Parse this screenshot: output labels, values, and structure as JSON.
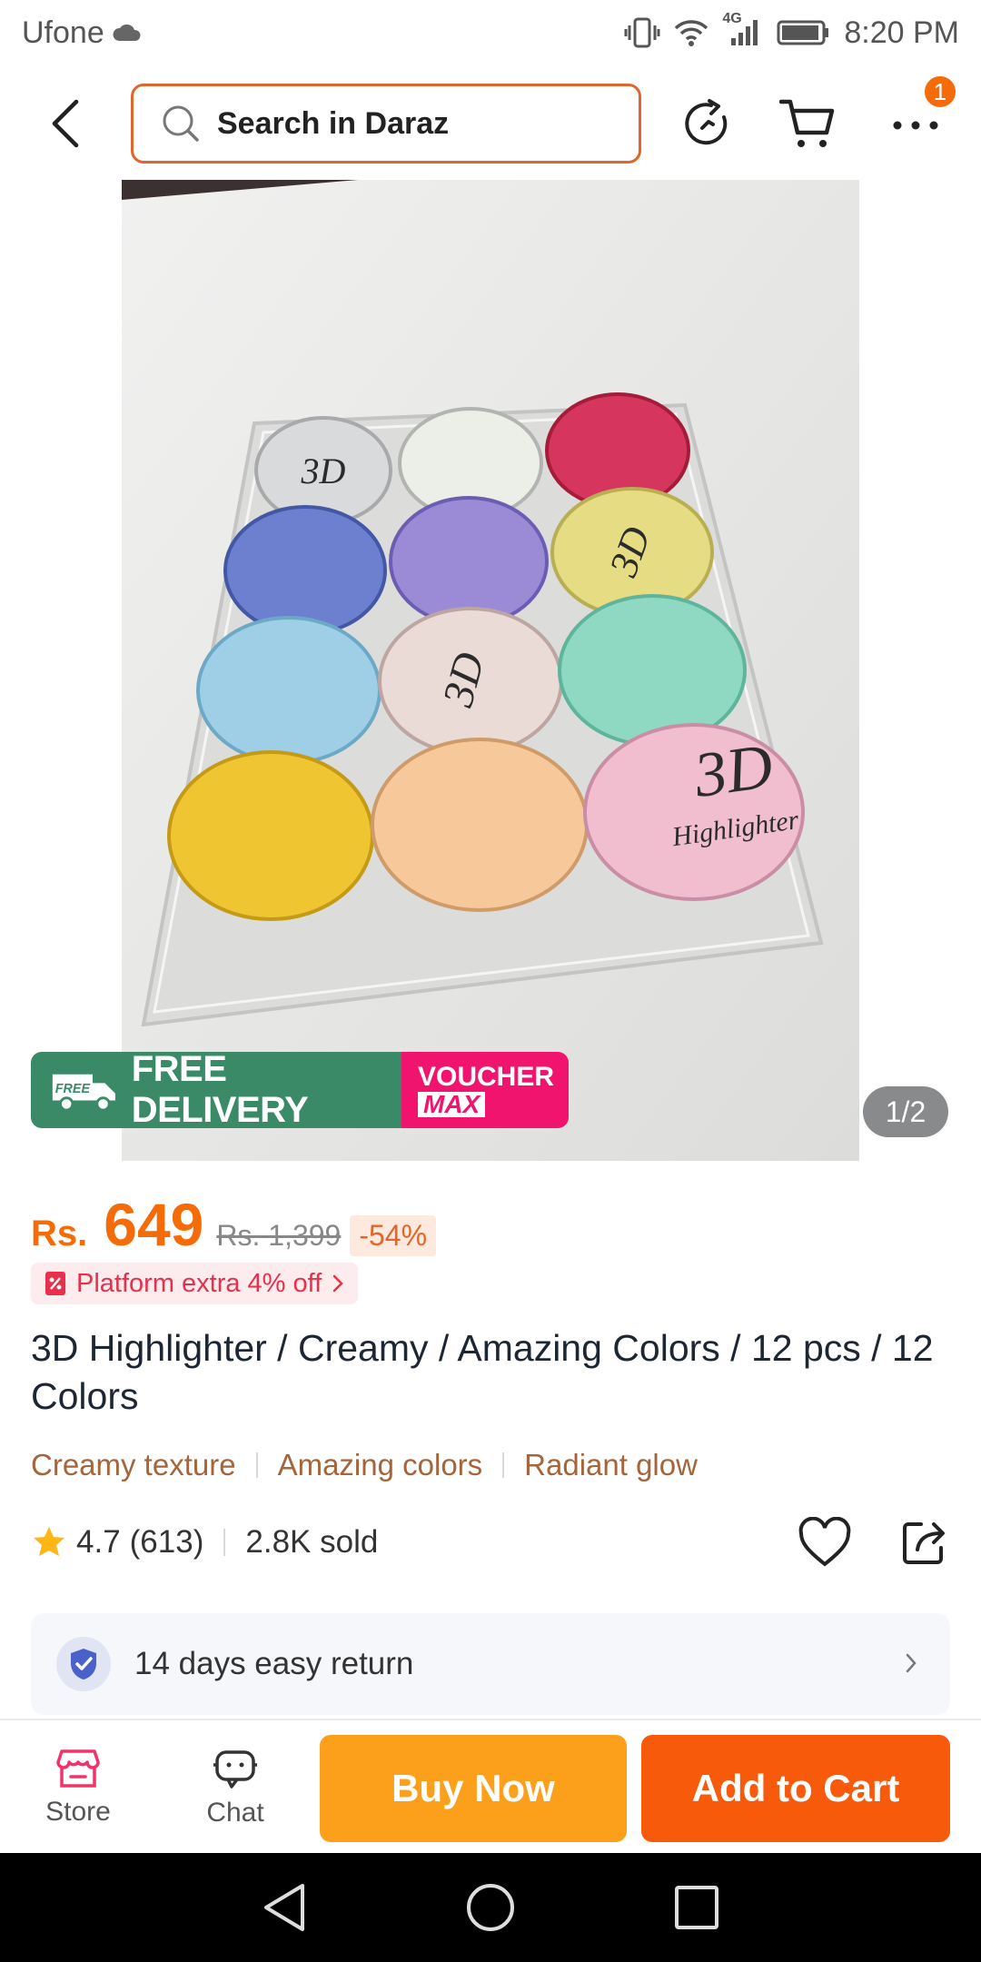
{
  "status_bar": {
    "carrier": "Ufone",
    "network": "4G",
    "time": "8:20 PM"
  },
  "top_bar": {
    "search_value": "Search in Daraz",
    "more_badge": "1"
  },
  "gallery": {
    "image_counter": "1/2",
    "promo": {
      "free_tag": "FREE",
      "free_delivery": "FREE DELIVERY",
      "voucher": "VOUCHER",
      "max": "MAX"
    },
    "product_label_line1": "3D",
    "product_label_line2": "Highlighter"
  },
  "price": {
    "currency": "Rs.",
    "current": "649",
    "original": "Rs. 1,399",
    "discount": "-54%"
  },
  "platform_offer": "Platform extra 4% off",
  "product": {
    "title": "3D Highlighter / Creamy / Amazing Colors / 12 pcs / 12 Colors",
    "features": [
      "Creamy texture",
      "Amazing colors",
      "Radiant glow"
    ]
  },
  "rating": {
    "score": "4.7",
    "count": "(613)",
    "sold": "2.8K sold"
  },
  "return_policy": "14 days easy return",
  "action_bar": {
    "store_label": "Store",
    "chat_label": "Chat",
    "buy_now": "Buy Now",
    "add_to_cart": "Add to Cart"
  },
  "colors": {
    "accent": "#f56b07",
    "buy_now": "#fca01b",
    "add_to_cart": "#f85a0c",
    "free_delivery_bg": "#3a8a67",
    "voucher_bg": "#f0146e"
  }
}
